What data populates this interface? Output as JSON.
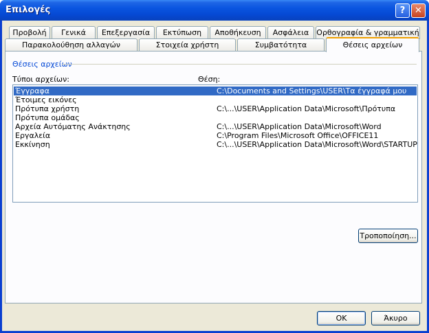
{
  "window": {
    "title": "Επιλογές"
  },
  "tabs_row1": [
    "Προβολή",
    "Γενικά",
    "Επεξεργασία",
    "Εκτύπωση",
    "Αποθήκευση",
    "Ασφάλεια",
    "Ορθογραφία & γραμματική"
  ],
  "tabs_row2": [
    "Παρακολούθηση αλλαγών",
    "Στοιχεία χρήστη",
    "Συμβατότητα",
    "Θέσεις αρχείων"
  ],
  "active_tab": "Θέσεις αρχείων",
  "panel": {
    "group_label": "Θέσεις αρχείων",
    "col_type_label": "Τύποι αρχείων:",
    "col_location_label": "Θέση:",
    "rows": [
      {
        "type": "Έγγραφα",
        "location": "C:\\Documents and Settings\\USER\\Τα έγγραφά μου",
        "selected": true
      },
      {
        "type": "Έτοιμες εικόνες",
        "location": ""
      },
      {
        "type": "Πρότυπα χρήστη",
        "location": "C:\\...\\USER\\Application Data\\Microsoft\\Πρότυπα"
      },
      {
        "type": "Πρότυπα ομάδας",
        "location": ""
      },
      {
        "type": "Αρχεία Αυτόματης Ανάκτησης",
        "location": "C:\\...\\USER\\Application Data\\Microsoft\\Word"
      },
      {
        "type": "Εργαλεία",
        "location": "C:\\Program Files\\Microsoft Office\\OFFICE11"
      },
      {
        "type": "Εκκίνηση",
        "location": "C:\\...\\USER\\Application Data\\Microsoft\\Word\\STARTUP"
      }
    ],
    "modify_button": "Τροποποίηση..."
  },
  "footer": {
    "ok": "OK",
    "cancel": "Άκυρο"
  },
  "colors": {
    "selection": "#316ac5",
    "group_label": "#0046d5",
    "face": "#ece9d8"
  }
}
